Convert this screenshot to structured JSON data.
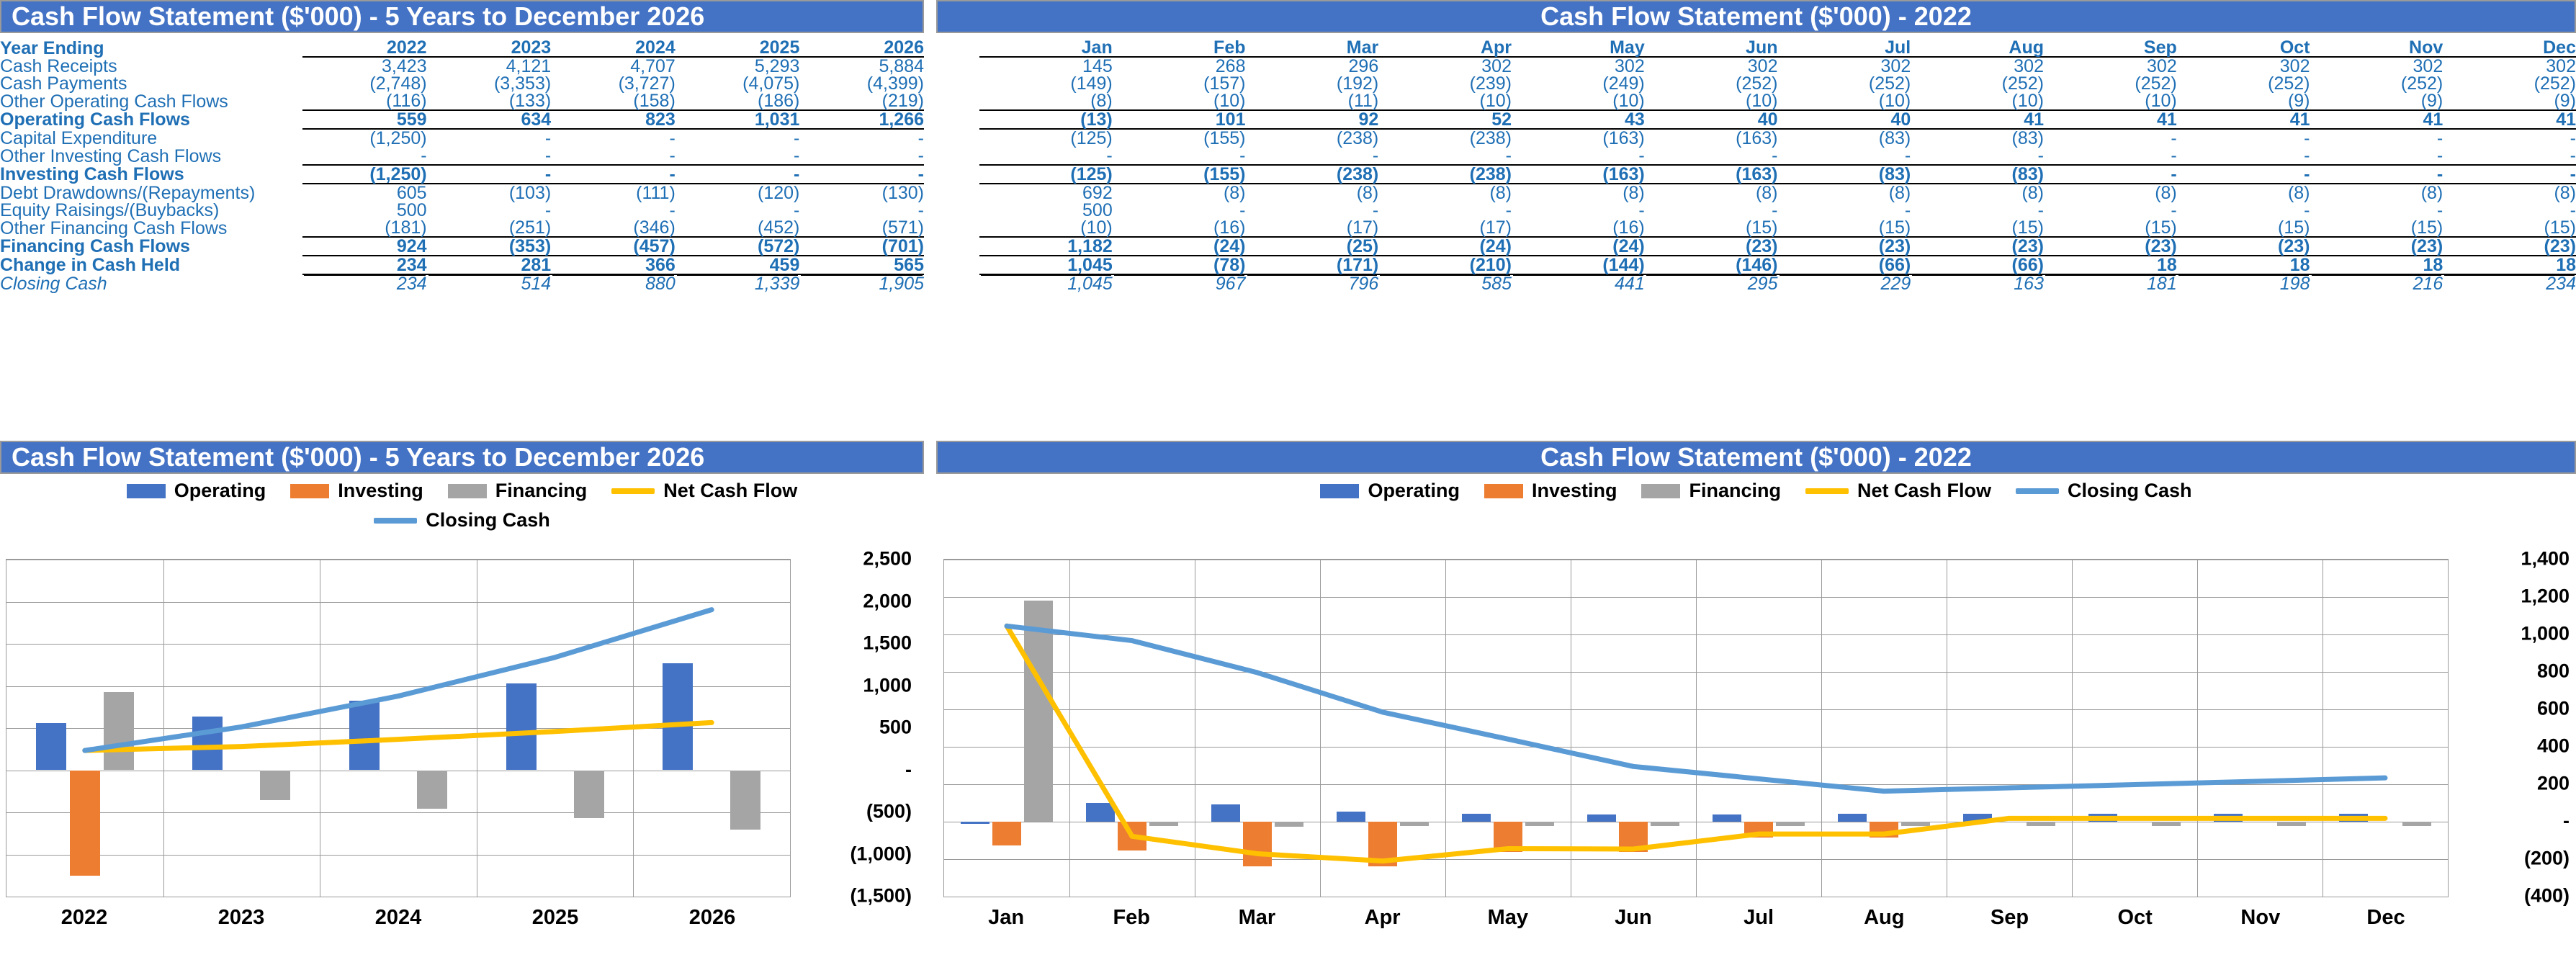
{
  "colors": {
    "header_blue": "#4472C4",
    "text_blue": "#1F6FB5",
    "operating": "#4472C4",
    "investing": "#ED7D31",
    "financing": "#A5A5A5",
    "net_cash_flow": "#FFC000",
    "closing_cash": "#5B9BD5"
  },
  "table_annual": {
    "title": "Cash Flow Statement ($'000) - 5 Years to December 2026",
    "header_label": "Year Ending",
    "columns": [
      "2022",
      "2023",
      "2024",
      "2025",
      "2026"
    ],
    "rows": [
      {
        "label": "Cash Receipts",
        "values": [
          "3,423",
          "4,121",
          "4,707",
          "5,293",
          "5,884"
        ]
      },
      {
        "label": "Cash Payments",
        "values": [
          "(2,748)",
          "(3,353)",
          "(3,727)",
          "(4,075)",
          "(4,399)"
        ]
      },
      {
        "label": "Other Operating Cash Flows",
        "values": [
          "(116)",
          "(133)",
          "(158)",
          "(186)",
          "(219)"
        ]
      },
      {
        "label": "Operating Cash Flows",
        "values": [
          "559",
          "634",
          "823",
          "1,031",
          "1,266"
        ]
      },
      {
        "label": "Capital Expenditure",
        "values": [
          "(1,250)",
          "-",
          "-",
          "-",
          "-"
        ]
      },
      {
        "label": "Other Investing Cash Flows",
        "values": [
          "-",
          "-",
          "-",
          "-",
          "-"
        ]
      },
      {
        "label": "Investing Cash Flows",
        "values": [
          "(1,250)",
          "-",
          "-",
          "-",
          "-"
        ]
      },
      {
        "label": "Debt Drawdowns/(Repayments)",
        "values": [
          "605",
          "(103)",
          "(111)",
          "(120)",
          "(130)"
        ]
      },
      {
        "label": "Equity Raisings/(Buybacks)",
        "values": [
          "500",
          "-",
          "-",
          "-",
          "-"
        ]
      },
      {
        "label": "Other Financing Cash Flows",
        "values": [
          "(181)",
          "(251)",
          "(346)",
          "(452)",
          "(571)"
        ]
      },
      {
        "label": "Financing Cash Flows",
        "values": [
          "924",
          "(353)",
          "(457)",
          "(572)",
          "(701)"
        ]
      },
      {
        "label": "Change in Cash Held",
        "values": [
          "234",
          "281",
          "366",
          "459",
          "565"
        ]
      },
      {
        "label": "Closing Cash",
        "values": [
          "234",
          "514",
          "880",
          "1,339",
          "1,905"
        ]
      }
    ]
  },
  "table_monthly": {
    "title": "Cash Flow Statement ($'000) - 2022",
    "columns": [
      "Jan",
      "Feb",
      "Mar",
      "Apr",
      "May",
      "Jun",
      "Jul",
      "Aug",
      "Sep",
      "Oct",
      "Nov",
      "Dec"
    ],
    "rows": [
      {
        "label": "Cash Receipts",
        "values": [
          "145",
          "268",
          "296",
          "302",
          "302",
          "302",
          "302",
          "302",
          "302",
          "302",
          "302",
          "302"
        ]
      },
      {
        "label": "Cash Payments",
        "values": [
          "(149)",
          "(157)",
          "(192)",
          "(239)",
          "(249)",
          "(252)",
          "(252)",
          "(252)",
          "(252)",
          "(252)",
          "(252)",
          "(252)"
        ]
      },
      {
        "label": "Other Operating Cash Flows",
        "values": [
          "(8)",
          "(10)",
          "(11)",
          "(10)",
          "(10)",
          "(10)",
          "(10)",
          "(10)",
          "(10)",
          "(9)",
          "(9)",
          "(9)"
        ]
      },
      {
        "label": "Operating Cash Flows",
        "values": [
          "(13)",
          "101",
          "92",
          "52",
          "43",
          "40",
          "40",
          "41",
          "41",
          "41",
          "41",
          "41"
        ]
      },
      {
        "label": "Capital Expenditure",
        "values": [
          "(125)",
          "(155)",
          "(238)",
          "(238)",
          "(163)",
          "(163)",
          "(83)",
          "(83)",
          "-",
          "-",
          "-",
          "-"
        ]
      },
      {
        "label": "Other Investing Cash Flows",
        "values": [
          "-",
          "-",
          "-",
          "-",
          "-",
          "-",
          "-",
          "-",
          "-",
          "-",
          "-",
          "-"
        ]
      },
      {
        "label": "Investing Cash Flows",
        "values": [
          "(125)",
          "(155)",
          "(238)",
          "(238)",
          "(163)",
          "(163)",
          "(83)",
          "(83)",
          "-",
          "-",
          "-",
          "-"
        ]
      },
      {
        "label": "Debt Drawdowns/(Repayments)",
        "values": [
          "692",
          "(8)",
          "(8)",
          "(8)",
          "(8)",
          "(8)",
          "(8)",
          "(8)",
          "(8)",
          "(8)",
          "(8)",
          "(8)"
        ]
      },
      {
        "label": "Equity Raisings/(Buybacks)",
        "values": [
          "500",
          "-",
          "-",
          "-",
          "-",
          "-",
          "-",
          "-",
          "-",
          "-",
          "-",
          "-"
        ]
      },
      {
        "label": "Other Financing Cash Flows",
        "values": [
          "(10)",
          "(16)",
          "(17)",
          "(17)",
          "(16)",
          "(15)",
          "(15)",
          "(15)",
          "(15)",
          "(15)",
          "(15)",
          "(15)"
        ]
      },
      {
        "label": "Financing Cash Flows",
        "values": [
          "1,182",
          "(24)",
          "(25)",
          "(24)",
          "(24)",
          "(23)",
          "(23)",
          "(23)",
          "(23)",
          "(23)",
          "(23)",
          "(23)"
        ]
      },
      {
        "label": "Change in Cash Held",
        "values": [
          "1,045",
          "(78)",
          "(171)",
          "(210)",
          "(144)",
          "(146)",
          "(66)",
          "(66)",
          "18",
          "18",
          "18",
          "18"
        ]
      },
      {
        "label": "Closing Cash",
        "values": [
          "1,045",
          "967",
          "796",
          "585",
          "441",
          "295",
          "229",
          "163",
          "181",
          "198",
          "216",
          "234"
        ]
      }
    ]
  },
  "legend": {
    "operating": "Operating",
    "investing": "Investing",
    "financing": "Financing",
    "net_cash_flow": "Net Cash Flow",
    "closing_cash": "Closing Cash"
  },
  "chart_data": [
    {
      "id": "annual",
      "type": "bar",
      "title": "Cash Flow Statement ($'000) - 5 Years to December 2026",
      "categories": [
        "2022",
        "2023",
        "2024",
        "2025",
        "2026"
      ],
      "series": [
        {
          "name": "Operating",
          "kind": "bar",
          "color": "#4472C4",
          "values": [
            559,
            634,
            823,
            1031,
            1266
          ]
        },
        {
          "name": "Investing",
          "kind": "bar",
          "color": "#ED7D31",
          "values": [
            -1250,
            0,
            0,
            0,
            0
          ]
        },
        {
          "name": "Financing",
          "kind": "bar",
          "color": "#A5A5A5",
          "values": [
            924,
            -353,
            -457,
            -572,
            -701
          ]
        },
        {
          "name": "Net Cash Flow",
          "kind": "line",
          "color": "#FFC000",
          "values": [
            234,
            281,
            366,
            459,
            565
          ]
        },
        {
          "name": "Closing Cash",
          "kind": "line",
          "color": "#5B9BD5",
          "values": [
            234,
            514,
            880,
            1339,
            1905
          ]
        }
      ],
      "ylim": [
        -1500,
        2500
      ],
      "yticks": [
        "2,500",
        "2,000",
        "1,500",
        "1,000",
        "500",
        "-",
        "(500)",
        "(1,000)",
        "(1,500)"
      ],
      "ytick_values": [
        2500,
        2000,
        1500,
        1000,
        500,
        0,
        -500,
        -1000,
        -1500
      ],
      "xlabel": "",
      "ylabel": "",
      "grid": true,
      "legend_position": "top"
    },
    {
      "id": "monthly",
      "type": "bar",
      "title": "Cash Flow Statement ($'000) - 2022",
      "categories": [
        "Jan",
        "Feb",
        "Mar",
        "Apr",
        "May",
        "Jun",
        "Jul",
        "Aug",
        "Sep",
        "Oct",
        "Nov",
        "Dec"
      ],
      "series": [
        {
          "name": "Operating",
          "kind": "bar",
          "color": "#4472C4",
          "values": [
            -13,
            101,
            92,
            52,
            43,
            40,
            40,
            41,
            41,
            41,
            41,
            41
          ]
        },
        {
          "name": "Investing",
          "kind": "bar",
          "color": "#ED7D31",
          "values": [
            -125,
            -155,
            -238,
            -238,
            -163,
            -163,
            -83,
            -83,
            0,
            0,
            0,
            0
          ]
        },
        {
          "name": "Financing",
          "kind": "bar",
          "color": "#A5A5A5",
          "values": [
            1182,
            -24,
            -25,
            -24,
            -24,
            -23,
            -23,
            -23,
            -23,
            -23,
            -23,
            -23
          ]
        },
        {
          "name": "Net Cash Flow",
          "kind": "line",
          "color": "#FFC000",
          "values": [
            1045,
            -78,
            -171,
            -210,
            -144,
            -146,
            -66,
            -66,
            18,
            18,
            18,
            18
          ]
        },
        {
          "name": "Closing Cash",
          "kind": "line",
          "color": "#5B9BD5",
          "values": [
            1045,
            967,
            796,
            585,
            441,
            295,
            229,
            163,
            181,
            198,
            216,
            234
          ]
        }
      ],
      "ylim": [
        -400,
        1400
      ],
      "yticks": [
        "1,400",
        "1,200",
        "1,000",
        "800",
        "600",
        "400",
        "200",
        "-",
        "(200)",
        "(400)"
      ],
      "ytick_values": [
        1400,
        1200,
        1000,
        800,
        600,
        400,
        200,
        0,
        -200,
        -400
      ],
      "xlabel": "",
      "ylabel": "",
      "grid": true,
      "legend_position": "top"
    }
  ]
}
